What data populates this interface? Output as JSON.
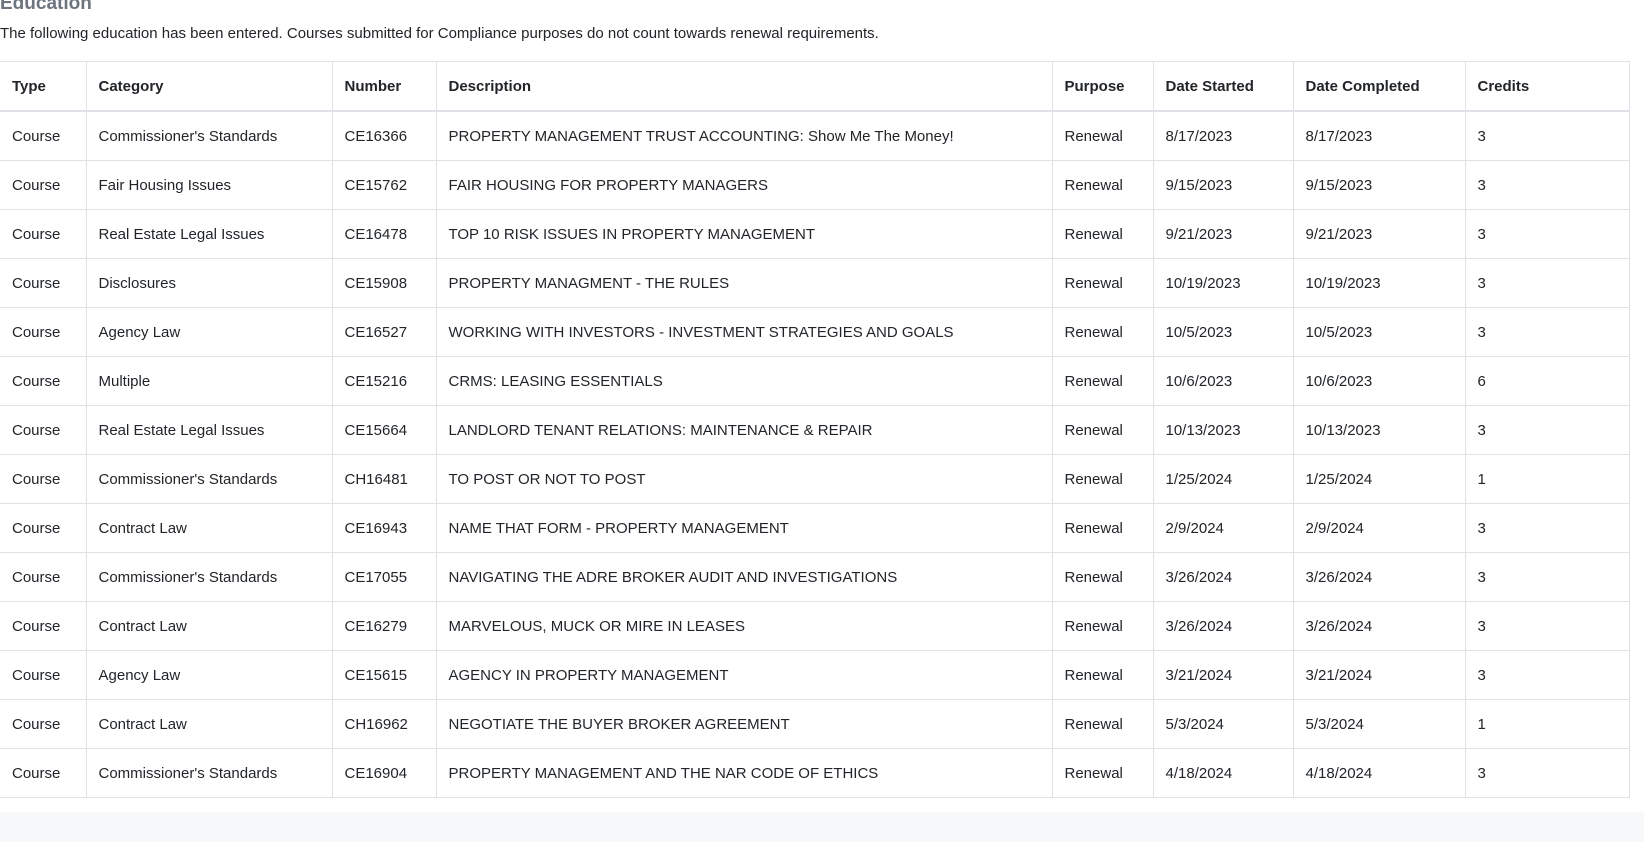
{
  "section": {
    "title": "Education",
    "description": "The following education has been entered. Courses submitted for Compliance purposes do not count towards renewal requirements."
  },
  "table": {
    "headers": [
      "Type",
      "Category",
      "Number",
      "Description",
      "Purpose",
      "Date Started",
      "Date Completed",
      "Credits"
    ],
    "rows": [
      [
        "Course",
        "Commissioner's Standards",
        "CE16366",
        "PROPERTY MANAGEMENT TRUST ACCOUNTING: Show Me The Money!",
        "Renewal",
        "8/17/2023",
        "8/17/2023",
        "3"
      ],
      [
        "Course",
        "Fair Housing Issues",
        "CE15762",
        "FAIR HOUSING FOR PROPERTY MANAGERS",
        "Renewal",
        "9/15/2023",
        "9/15/2023",
        "3"
      ],
      [
        "Course",
        "Real Estate Legal Issues",
        "CE16478",
        "TOP 10 RISK ISSUES IN PROPERTY MANAGEMENT",
        "Renewal",
        "9/21/2023",
        "9/21/2023",
        "3"
      ],
      [
        "Course",
        "Disclosures",
        "CE15908",
        "PROPERTY MANAGMENT - THE RULES",
        "Renewal",
        "10/19/2023",
        "10/19/2023",
        "3"
      ],
      [
        "Course",
        "Agency Law",
        "CE16527",
        "WORKING WITH INVESTORS - INVESTMENT STRATEGIES AND GOALS",
        "Renewal",
        "10/5/2023",
        "10/5/2023",
        "3"
      ],
      [
        "Course",
        "Multiple",
        "CE15216",
        "CRMS: LEASING ESSENTIALS",
        "Renewal",
        "10/6/2023",
        "10/6/2023",
        "6"
      ],
      [
        "Course",
        "Real Estate Legal Issues",
        "CE15664",
        "LANDLORD TENANT RELATIONS: MAINTENANCE & REPAIR",
        "Renewal",
        "10/13/2023",
        "10/13/2023",
        "3"
      ],
      [
        "Course",
        "Commissioner's Standards",
        "CH16481",
        "TO POST OR NOT TO POST",
        "Renewal",
        "1/25/2024",
        "1/25/2024",
        "1"
      ],
      [
        "Course",
        "Contract Law",
        "CE16943",
        "NAME THAT FORM - PROPERTY MANAGEMENT",
        "Renewal",
        "2/9/2024",
        "2/9/2024",
        "3"
      ],
      [
        "Course",
        "Commissioner's Standards",
        "CE17055",
        "NAVIGATING THE ADRE BROKER AUDIT AND INVESTIGATIONS",
        "Renewal",
        "3/26/2024",
        "3/26/2024",
        "3"
      ],
      [
        "Course",
        "Contract Law",
        "CE16279",
        "MARVELOUS, MUCK OR MIRE IN LEASES",
        "Renewal",
        "3/26/2024",
        "3/26/2024",
        "3"
      ],
      [
        "Course",
        "Agency Law",
        "CE15615",
        "AGENCY IN PROPERTY MANAGEMENT",
        "Renewal",
        "3/21/2024",
        "3/21/2024",
        "3"
      ],
      [
        "Course",
        "Contract Law",
        "CH16962",
        "NEGOTIATE THE BUYER BROKER AGREEMENT",
        "Renewal",
        "5/3/2024",
        "5/3/2024",
        "1"
      ],
      [
        "Course",
        "Commissioner's Standards",
        "CE16904",
        "PROPERTY MANAGEMENT AND THE NAR CODE OF ETHICS",
        "Renewal",
        "4/18/2024",
        "4/18/2024",
        "3"
      ]
    ]
  }
}
